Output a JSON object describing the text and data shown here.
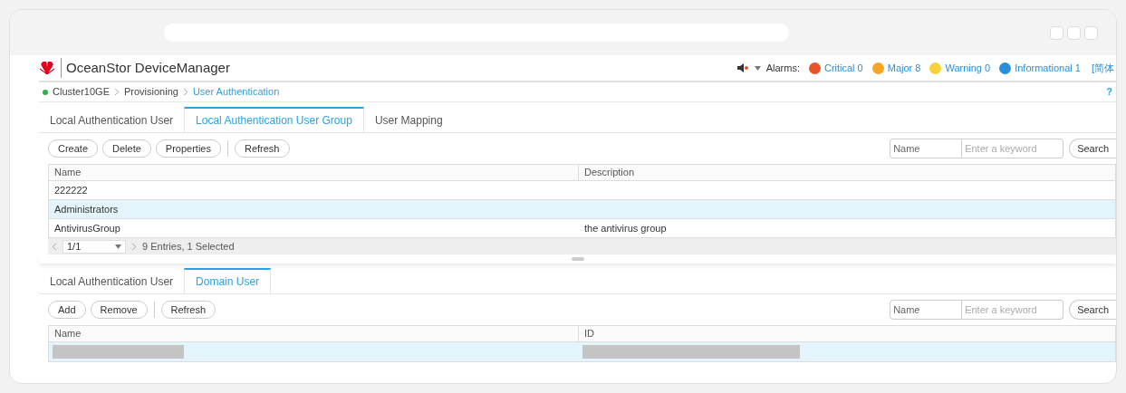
{
  "app": {
    "title": "OceanStor DeviceManager"
  },
  "alarms": {
    "label": "Alarms:",
    "items": [
      {
        "label": "Critical 0",
        "color": "#e8542a"
      },
      {
        "label": "Major 8",
        "color": "#f5a623"
      },
      {
        "label": "Warning 0",
        "color": "#f8d23a"
      },
      {
        "label": "Informational 1",
        "color": "#2a8fd8"
      }
    ],
    "language": "[简体"
  },
  "breadcrumb": [
    {
      "label": "Cluster10GE",
      "selected": false
    },
    {
      "label": "Provisioning",
      "selected": false
    },
    {
      "label": "User Authentication",
      "selected": true
    }
  ],
  "help": "?",
  "upper": {
    "tabs": [
      {
        "label": "Local Authentication User",
        "selected": false
      },
      {
        "label": "Local Authentication User Group",
        "selected": true
      },
      {
        "label": "User Mapping",
        "selected": false
      }
    ],
    "buttons": [
      "Create",
      "Delete",
      "Properties",
      "Refresh"
    ],
    "search": {
      "field": "Name",
      "placeholder": "Enter a keyword",
      "button": "Search"
    },
    "columns": [
      "Name",
      "Description"
    ],
    "rows": [
      {
        "cells": [
          "222222",
          ""
        ],
        "selected": false
      },
      {
        "cells": [
          "Administrators",
          ""
        ],
        "selected": true
      },
      {
        "cells": [
          "AntivirusGroup",
          "the antivirus group"
        ],
        "selected": false
      }
    ],
    "pager": {
      "page": "1/1",
      "summary": "9 Entries, 1 Selected"
    }
  },
  "lower": {
    "tabs": [
      {
        "label": "Local Authentication User",
        "selected": false
      },
      {
        "label": "Domain User",
        "selected": true
      }
    ],
    "buttons": [
      "Add",
      "Remove",
      "Refresh"
    ],
    "search": {
      "field": "Name",
      "placeholder": "Enter a keyword",
      "button": "Search"
    },
    "columns": [
      "Name",
      "ID"
    ],
    "rows": [
      {
        "selected": true
      }
    ]
  }
}
